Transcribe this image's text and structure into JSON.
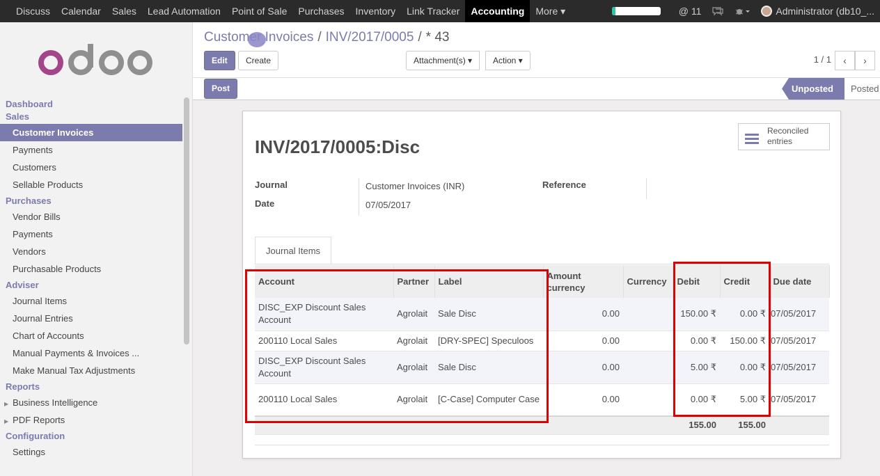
{
  "topbar": {
    "menu": [
      "Discuss",
      "Calendar",
      "Sales",
      "Lead Automation",
      "Point of Sale",
      "Purchases",
      "Inventory",
      "Link Tracker",
      "Accounting",
      "More ▾"
    ],
    "active_index": 8,
    "progress_fraction": 0.08,
    "messages_count": "@ 11",
    "user": "Administrator (db10_..."
  },
  "sidebar": {
    "sections": [
      {
        "title": "Dashboard",
        "items": []
      },
      {
        "title": "Sales",
        "items": [
          "Customer Invoices",
          "Payments",
          "Customers",
          "Sellable Products"
        ]
      },
      {
        "title": "Purchases",
        "items": [
          "Vendor Bills",
          "Payments",
          "Vendors",
          "Purchasable Products"
        ]
      },
      {
        "title": "Adviser",
        "items": [
          "Journal Items",
          "Journal Entries",
          "Chart of Accounts",
          "Manual Payments & Invoices ...",
          "Make Manual Tax Adjustments"
        ]
      },
      {
        "title": "Reports",
        "items": [
          "Business Intelligence",
          "PDF Reports"
        ]
      },
      {
        "title": "Configuration",
        "items": [
          "Settings"
        ]
      }
    ],
    "active_item": "Customer Invoices"
  },
  "control_panel": {
    "breadcrumb_1": "Customer Invoices",
    "breadcrumb_2": "INV/2017/0005",
    "breadcrumb_3": "* 43",
    "edit_label": "Edit",
    "create_label": "Create",
    "attachments_label": "Attachment(s) ▾",
    "action_label": "Action ▾",
    "pager": "1 / 1"
  },
  "statusbar": {
    "post_label": "Post",
    "unposted_label": "Unposted",
    "posted_label": "Posted"
  },
  "form": {
    "title": "INV/2017/0005:Disc",
    "reconciled_label": "Reconciled entries",
    "journal_label": "Journal",
    "journal_value": "Customer Invoices (INR)",
    "date_label": "Date",
    "date_value": "07/05/2017",
    "reference_label": "Reference",
    "tab_label": "Journal Items"
  },
  "journal_items": {
    "columns": [
      "Account",
      "Partner",
      "Label",
      "Amount currency",
      "Currency",
      "Debit",
      "Credit",
      "Due date"
    ],
    "rows": [
      {
        "account": "DISC_EXP Discount Sales Account",
        "partner": "Agrolait",
        "label": "Sale Disc",
        "amount_currency": "0.00",
        "currency": "",
        "debit": "150.00 ₹",
        "credit": "0.00 ₹",
        "due_date": "07/05/2017"
      },
      {
        "account": "200110 Local Sales",
        "partner": "Agrolait",
        "label": "[DRY-SPEC] Speculoos",
        "amount_currency": "0.00",
        "currency": "",
        "debit": "0.00 ₹",
        "credit": "150.00 ₹",
        "due_date": "07/05/2017"
      },
      {
        "account": "DISC_EXP Discount Sales Account",
        "partner": "Agrolait",
        "label": "Sale Disc",
        "amount_currency": "0.00",
        "currency": "",
        "debit": "5.00 ₹",
        "credit": "0.00 ₹",
        "due_date": "07/05/2017"
      },
      {
        "account": "200110 Local Sales",
        "partner": "Agrolait",
        "label": "[C-Case] Computer Case",
        "amount_currency": "0.00",
        "currency": "",
        "debit": "0.00 ₹",
        "credit": "5.00 ₹",
        "due_date": "07/05/2017"
      }
    ],
    "total_debit": "155.00",
    "total_credit": "155.00"
  },
  "colors": {
    "brand": "#7c7bad",
    "topbar_bg": "#2b2b2b",
    "highlight_red": "#e00000",
    "progress": "#2ec4a6"
  }
}
